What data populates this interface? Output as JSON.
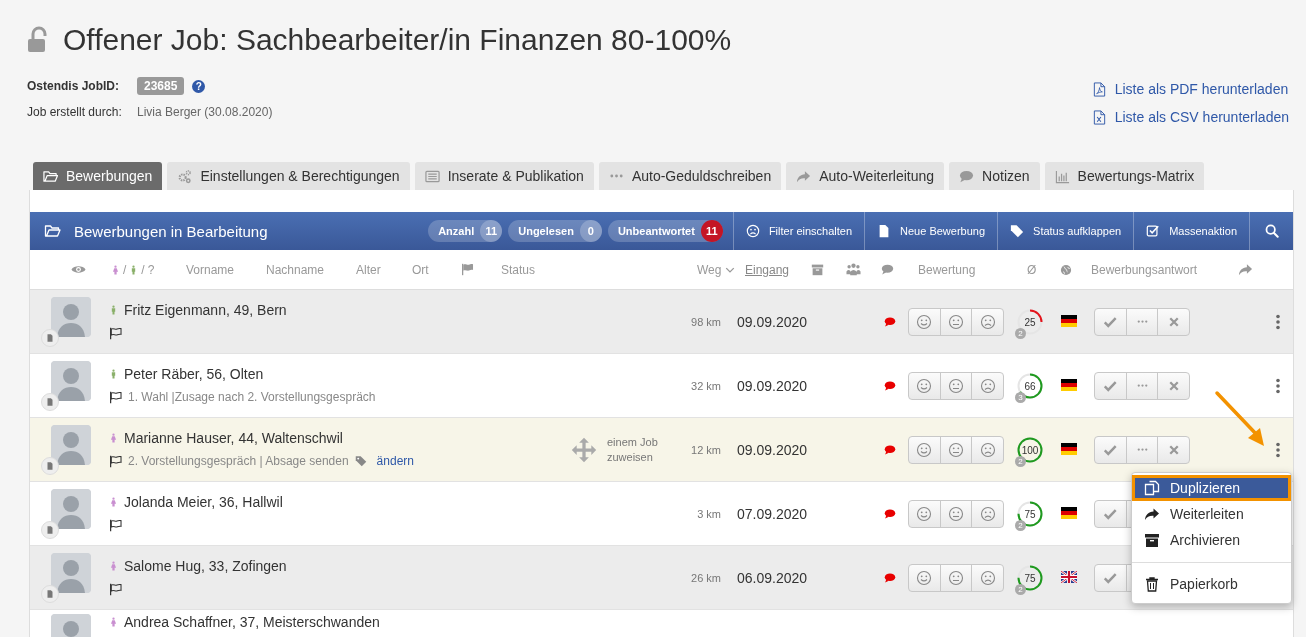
{
  "page": {
    "title": "Offener Job: Sachbearbeiter/in Finanzen 80-100%",
    "locked": false
  },
  "job_meta": [
    {
      "label": "Ostendis JobID:",
      "value": "23685",
      "kind": "badge",
      "help": "?"
    },
    {
      "label": "Job erstellt durch:",
      "value": "Livia Berger (30.08.2020)",
      "kind": "text"
    }
  ],
  "downloads": [
    {
      "label": "Liste als PDF herunterladen",
      "kind": "pdf"
    },
    {
      "label": "Liste als CSV herunterladen",
      "kind": "csv"
    }
  ],
  "tabs": [
    {
      "label": "Bewerbungen",
      "kind": "folder",
      "selected": true
    },
    {
      "label": "Einstellungen & Berechtigungen",
      "kind": "gears",
      "selected": false
    },
    {
      "label": "Inserate & Publikation",
      "kind": "list",
      "selected": false
    },
    {
      "label": "Auto-Geduldschreiben",
      "kind": "dots",
      "selected": false
    },
    {
      "label": "Auto-Weiterleitung",
      "kind": "share",
      "selected": false
    },
    {
      "label": "Notizen",
      "kind": "bubble",
      "selected": false
    },
    {
      "label": "Bewertungs-Matrix",
      "kind": "bars",
      "selected": false
    }
  ],
  "panel_header": {
    "title": "Bewerbungen in Bearbeitung",
    "counters": [
      {
        "label": "Anzahl",
        "count": "11",
        "alert": false
      },
      {
        "label": "Ungelesen",
        "count": "0",
        "alert": false
      },
      {
        "label": "Unbeantwortet",
        "count": "11",
        "alert": true
      }
    ],
    "actions": [
      {
        "label": "Filter einschalten",
        "kind": "frown"
      },
      {
        "label": "Neue Bewerbung",
        "kind": "file"
      },
      {
        "label": "Status aufklappen",
        "kind": "tag"
      },
      {
        "label": "Massenaktion",
        "kind": "checkbox"
      }
    ]
  },
  "columns": [
    {
      "kind": "eye"
    },
    {
      "kind": "gender",
      "separators": [
        "/",
        "/"
      ],
      "label": "?"
    },
    {
      "kind": "text",
      "label": "Vorname"
    },
    {
      "kind": "text",
      "label": "Nachname"
    },
    {
      "kind": "text",
      "label": "Alter"
    },
    {
      "kind": "text",
      "label": "Ort"
    },
    {
      "kind": "flag"
    },
    {
      "kind": "text",
      "label": "Status"
    },
    {
      "kind": "text",
      "label": "Weg"
    },
    {
      "kind": "chevron"
    },
    {
      "kind": "sorted",
      "label": "Eingang"
    },
    {
      "kind": "archive"
    },
    {
      "kind": "group"
    },
    {
      "kind": "comment"
    },
    {
      "kind": "text",
      "label": "Bewertung"
    },
    {
      "kind": "text",
      "label": "Ø"
    },
    {
      "kind": "globe"
    },
    {
      "kind": "text",
      "label": "Bewerbungsantwort"
    },
    {
      "kind": "share"
    }
  ],
  "rows": [
    {
      "name": "Fritz Eigenmann, 49, Bern",
      "female": false,
      "hovered": false,
      "distance": "98 km",
      "date": "09.09.2020",
      "has_comment": true,
      "score": "25",
      "level": 0.25,
      "score_count": "2",
      "uk_flag": false
    },
    {
      "name": "Peter Räber, 56, Olten",
      "female": false,
      "hovered": false,
      "status": "1. Wahl |Zusage nach 2. Vorstellungsgespräch",
      "distance": "32 km",
      "date": "09.09.2020",
      "has_comment": true,
      "score": "66",
      "level": 0.66,
      "score_count": "3",
      "uk_flag": false
    },
    {
      "name": "Marianne Hauser, 44, Waltenschwil",
      "female": true,
      "hovered": true,
      "status": "2. Vorstellungsgespräch | Absage senden",
      "tag_link": "ändern",
      "assign_label": "einem Job zuweisen",
      "distance": "12 km",
      "date": "09.09.2020",
      "has_comment": true,
      "score": "100",
      "level": 1,
      "score_count": "2",
      "uk_flag": false
    },
    {
      "name": "Jolanda Meier, 36, Hallwil",
      "female": true,
      "hovered": false,
      "distance": "3 km",
      "date": "07.09.2020",
      "has_comment": true,
      "score": "75",
      "level": 0.75,
      "score_count": "2",
      "uk_flag": false
    },
    {
      "name": "Salome Hug, 33, Zofingen",
      "female": true,
      "hovered": false,
      "distance": "26 km",
      "date": "06.09.2020",
      "has_comment": true,
      "score": "75",
      "level": 0.75,
      "score_count": "2",
      "uk_flag": true
    },
    {
      "name": "Andrea Schaffner, 37, Meisterschwanden",
      "female": true,
      "hovered": false
    }
  ],
  "row_menu": [
    {
      "label": "Duplizieren",
      "kind": "duplicate",
      "selected": true,
      "divider_before": false
    },
    {
      "label": "Weiterleiten",
      "kind": "forward",
      "selected": false,
      "divider_before": false
    },
    {
      "label": "Archivieren",
      "kind": "archive",
      "selected": false,
      "divider_before": false
    },
    {
      "label": "Papierkorb",
      "kind": "trash",
      "selected": false,
      "divider_before": true
    }
  ]
}
